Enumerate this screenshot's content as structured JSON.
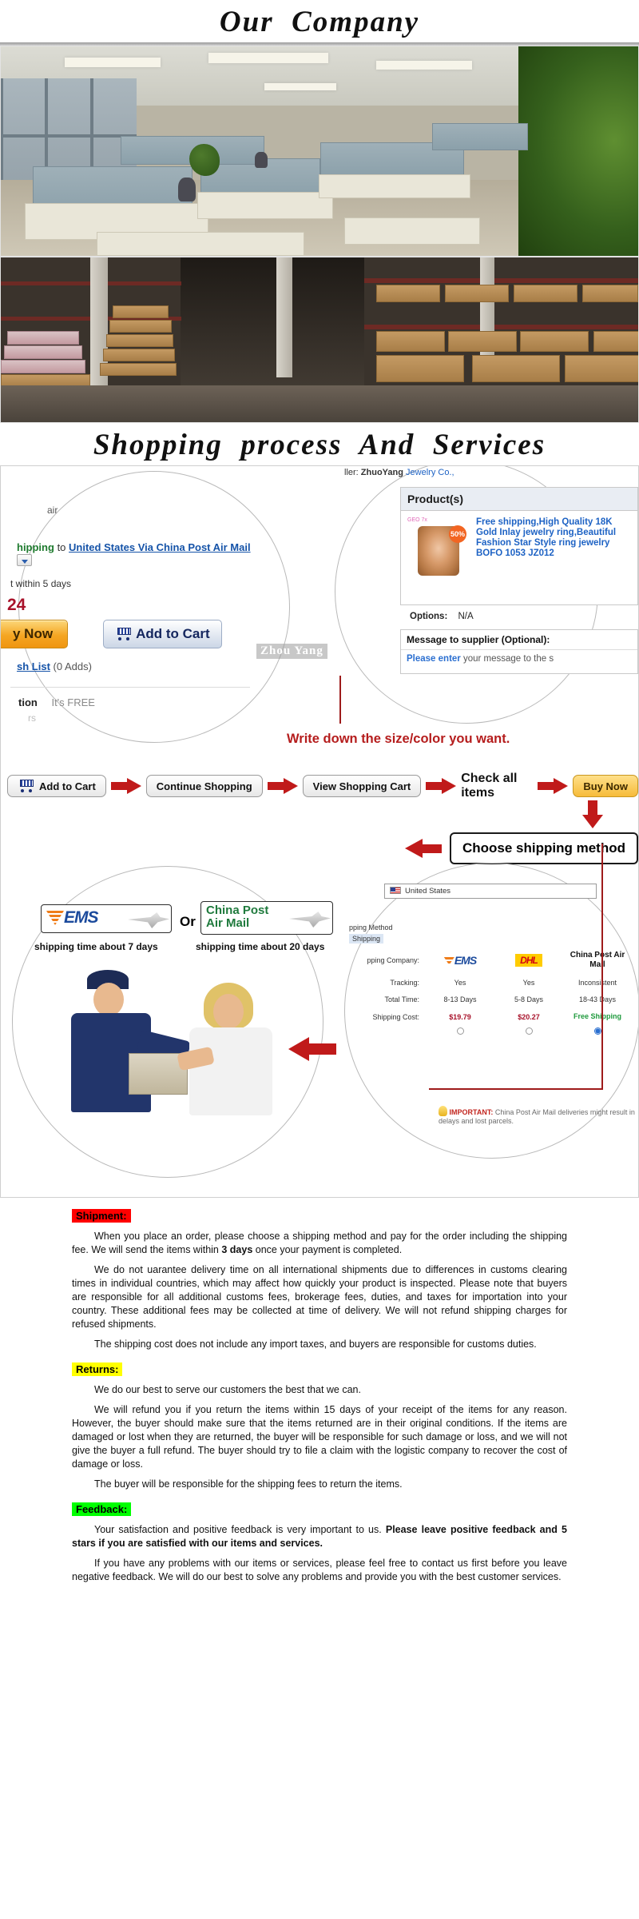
{
  "headings": {
    "company": "Our  Company",
    "process": "Shopping  process  And  Services"
  },
  "photos": {
    "office_alt": "office-interior-photo",
    "warehouse_alt": "warehouse-interior-photo"
  },
  "process_diagram": {
    "left_circle": {
      "partial_top": "air",
      "shipping_label": "hipping",
      "to_word": "to",
      "destination": "United States Via China  Post Air Mail",
      "dispatch": "t within 5 days",
      "price_fragment": "24",
      "buy_now": "y Now",
      "add_to_cart": "Add to Cart",
      "wish_list": "sh List",
      "wish_count": "(0 Adds)",
      "protection": "tion",
      "free_note": "It's FREE",
      "watermark": "Zhou Yang"
    },
    "right_circle": {
      "seller_prefix": "ller:",
      "seller_name": "ZhuoYang",
      "seller_suffix": "Jewelry Co.,",
      "products_header": "Product(s)",
      "discount_badge": "50%",
      "product_title": "Free shipping,High Quality 18K Gold Inlay jewelry ring,Beautiful Fashion Star Style ring jewelry BOFO 1053 JZ012",
      "options_label": "Options:",
      "options_value": "N/A",
      "message_label": "Message to supplier (Optional):",
      "message_placeholder_bold": "Please enter",
      "message_placeholder_rest": " your message to the s"
    },
    "annotation": "Write down the size/color you want.",
    "steps": [
      {
        "type": "button",
        "label": "Add to Cart",
        "icon": "cart-icon"
      },
      {
        "type": "arrow",
        "label": "arrow-right"
      },
      {
        "type": "button",
        "label": "Continue Shopping"
      },
      {
        "type": "arrow",
        "label": "arrow-right"
      },
      {
        "type": "button",
        "label": "View Shopping Cart"
      },
      {
        "type": "arrow",
        "label": "arrow-right"
      },
      {
        "type": "text",
        "label": "Check all items"
      },
      {
        "type": "arrow",
        "label": "arrow-right"
      },
      {
        "type": "button-amber",
        "label": "Buy Now"
      }
    ],
    "choose_shipping": "Choose shipping method",
    "couriers": {
      "ems_logo": "EMS",
      "or": "Or",
      "china_post_line1": "China Post",
      "china_post_line2": "Air Mail",
      "ems_caption": "shipping time about 7 days",
      "cp_caption": "shipping time about 20 days"
    },
    "ship_table": {
      "country": "United States",
      "method_label": "pping Method",
      "method_value": "Shipping",
      "company_label": "pping Company:",
      "columns": [
        "EMS",
        "DHL",
        "China Post Air Mail"
      ],
      "rows": [
        {
          "label": "Tracking:",
          "values": [
            "Yes",
            "Yes",
            "Inconsistent"
          ]
        },
        {
          "label": "Total Time:",
          "values": [
            "8-13 Days",
            "5-8 Days",
            "18-43 Days"
          ]
        },
        {
          "label": "Shipping Cost:",
          "values": [
            "$19.79",
            "$20.27",
            "Free Shipping"
          ]
        }
      ],
      "selected_index": 2,
      "important_tag": "IMPORTANT:",
      "important_text": "China Post Air Mail deliveries might result in delays and lost parcels."
    }
  },
  "policy": {
    "shipment": {
      "tag": "Shipment:",
      "p1_a": "When you place an order, please choose a shipping method and pay for the order including the shipping fee. We will send the items within ",
      "p1_b": "3 days",
      "p1_c": " once your payment is completed.",
      "p2": "We do not uarantee delivery time on all international shipments due to differences in customs clearing times in individual countries, which may affect how quickly your product is inspected. Please note that buyers are responsible for all additional customs fees, brokerage fees, duties, and taxes for importation into your country. These additional fees may be collected at time of delivery. We will not refund shipping charges for refused shipments.",
      "p3": "The shipping cost does not include any import taxes, and buyers are responsible for customs duties."
    },
    "returns": {
      "tag": "Returns:",
      "p1": "We do our best to serve our customers the best that we can.",
      "p2": "We will refund you if you return the items within 15 days of your receipt of the items for any reason.  However, the buyer should make sure that the items returned are in their original conditions.   If the items are damaged or lost when they are returned, the buyer will be responsible for such damage or loss, and we will not give the buyer a full refund.   The buyer should try to file a claim with the logistic company to recover the cost of damage or loss.",
      "p3": "The buyer will be responsible for the shipping fees to return the items."
    },
    "feedback": {
      "tag": "Feedback:",
      "p1_a": "Your satisfaction and positive feedback is very important to us.  ",
      "p1_b": "Please leave positive feedback and 5 stars if you are satisfied with our items and services.",
      "p2": "If you have any problems with our items or services, please feel free to contact us first before you leave negative feedback.   We will do our best to solve any problems and provide you with the best customer services."
    }
  },
  "colors": {
    "red_tag": "#ff0000",
    "yellow_tag": "#ffff00",
    "green_tag": "#00ff00",
    "arrow_red": "#c01a1a",
    "note_red": "#b51d1d",
    "link_blue": "#1553a8",
    "amber": "#f5a623"
  }
}
